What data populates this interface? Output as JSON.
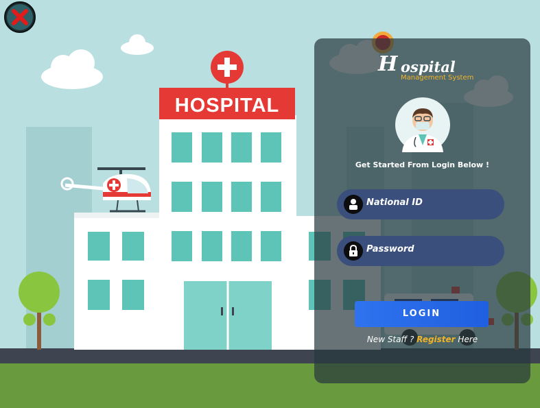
{
  "brand": {
    "initial": "H",
    "rest": "ospital",
    "subtitle": "Management System",
    "accent_color": "#f0b429"
  },
  "background": {
    "sign_text": "HOSPITAL"
  },
  "icons": {
    "close": "close-x-icon",
    "user": "user-icon",
    "lock": "lock-icon",
    "doctor": "doctor-avatar-icon"
  },
  "login": {
    "tagline": "Get Started From Login Below !",
    "national_id_placeholder": "National ID",
    "password_placeholder": "Password",
    "login_button": "LOGIN"
  },
  "register": {
    "prefix": "New Staff ?",
    "link": "Register",
    "suffix": "Here"
  },
  "colors": {
    "sky": "#b9dfe0",
    "field": "#3a4f7c",
    "button": "#2f73ee"
  }
}
